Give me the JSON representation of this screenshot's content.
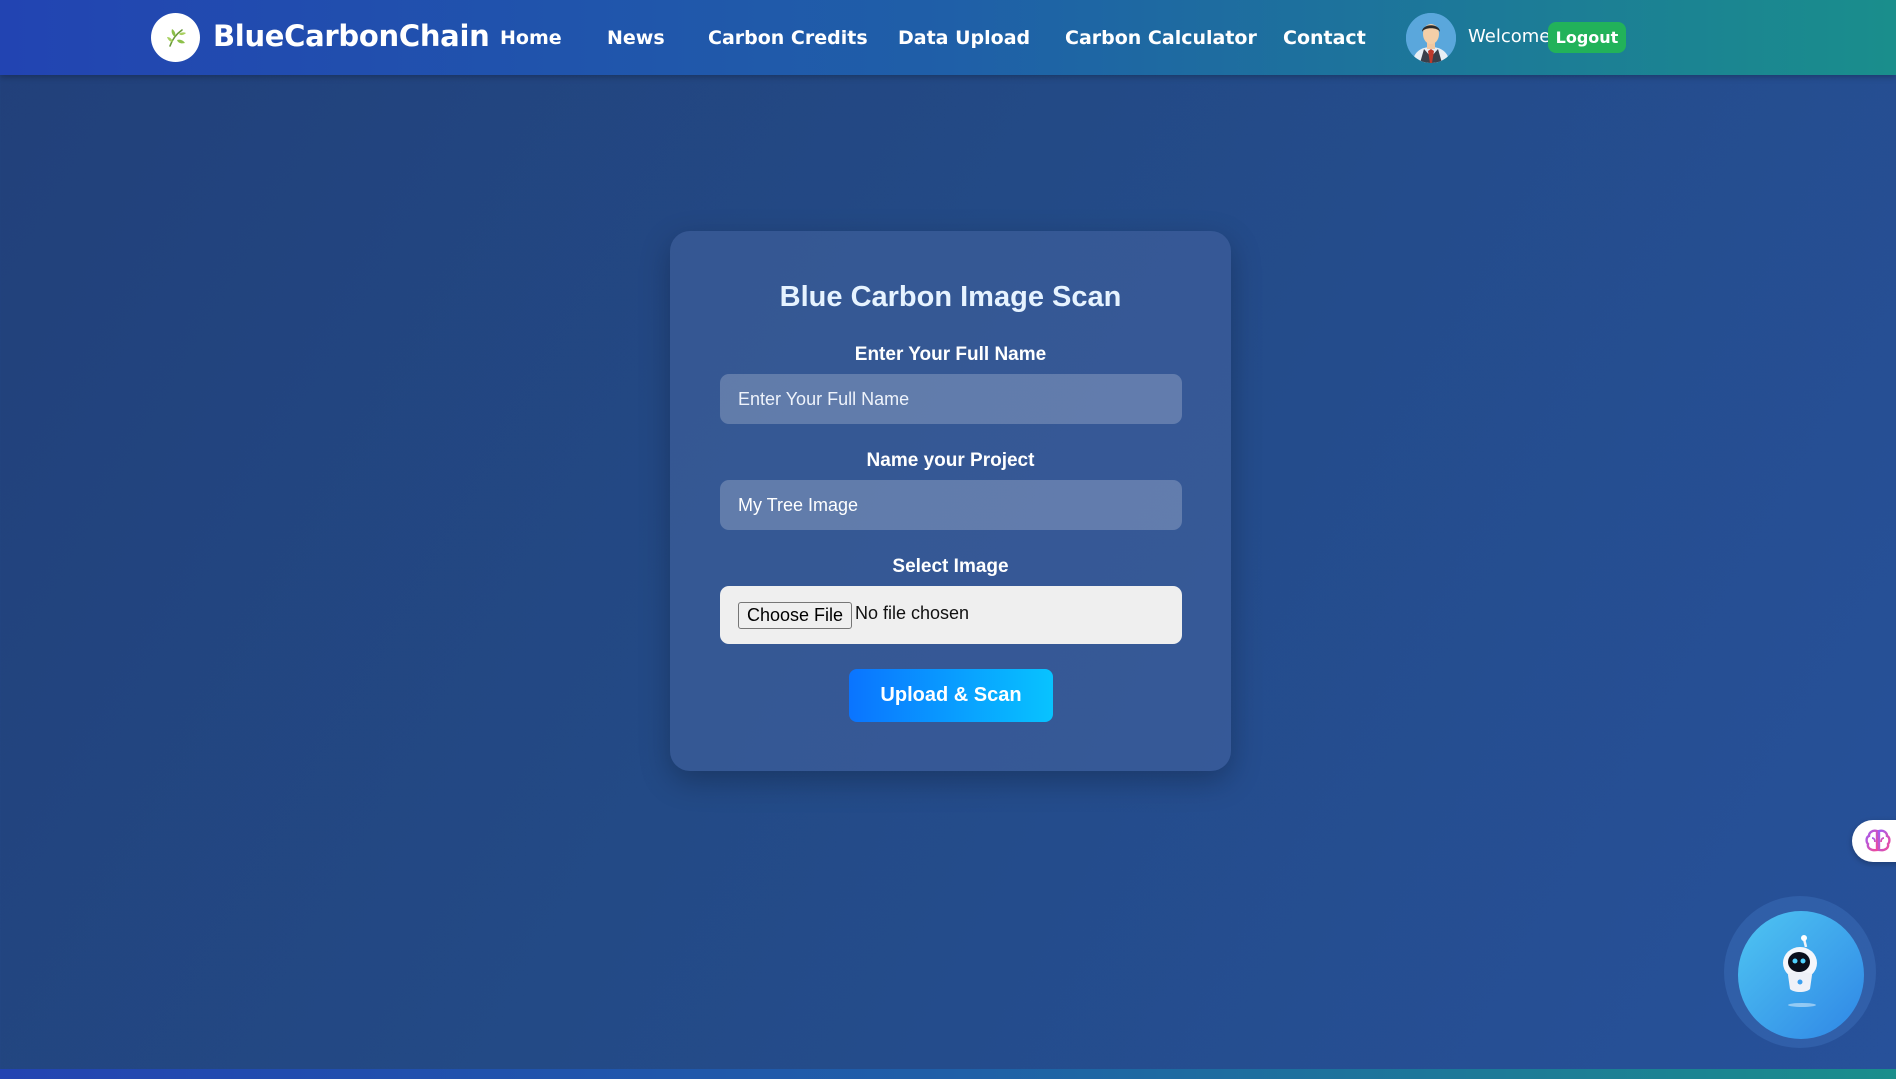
{
  "brand": {
    "name": "BlueCarbonChain"
  },
  "nav": {
    "items": [
      {
        "label": "Home"
      },
      {
        "label": "News"
      },
      {
        "label": "Carbon Credits"
      },
      {
        "label": "Data Upload"
      },
      {
        "label": "Carbon Calculator"
      },
      {
        "label": "Contact"
      }
    ],
    "welcome": "Welcome,",
    "logout": "Logout"
  },
  "form": {
    "title": "Blue Carbon Image Scan",
    "full_name": {
      "label": "Enter Your Full Name",
      "placeholder": "Enter Your Full Name",
      "value": ""
    },
    "project": {
      "label": "Name your Project",
      "value": "My Tree Image"
    },
    "image": {
      "label": "Select Image",
      "button": "Choose File",
      "status": "No file chosen"
    },
    "submit": "Upload & Scan"
  },
  "widgets": {
    "side_icon": "brain-icon",
    "bot_icon": "robot-icon"
  },
  "colors": {
    "logout_green": "#22b25a",
    "accent_blue": "#0a74ff",
    "accent_cyan": "#08c3ff"
  }
}
